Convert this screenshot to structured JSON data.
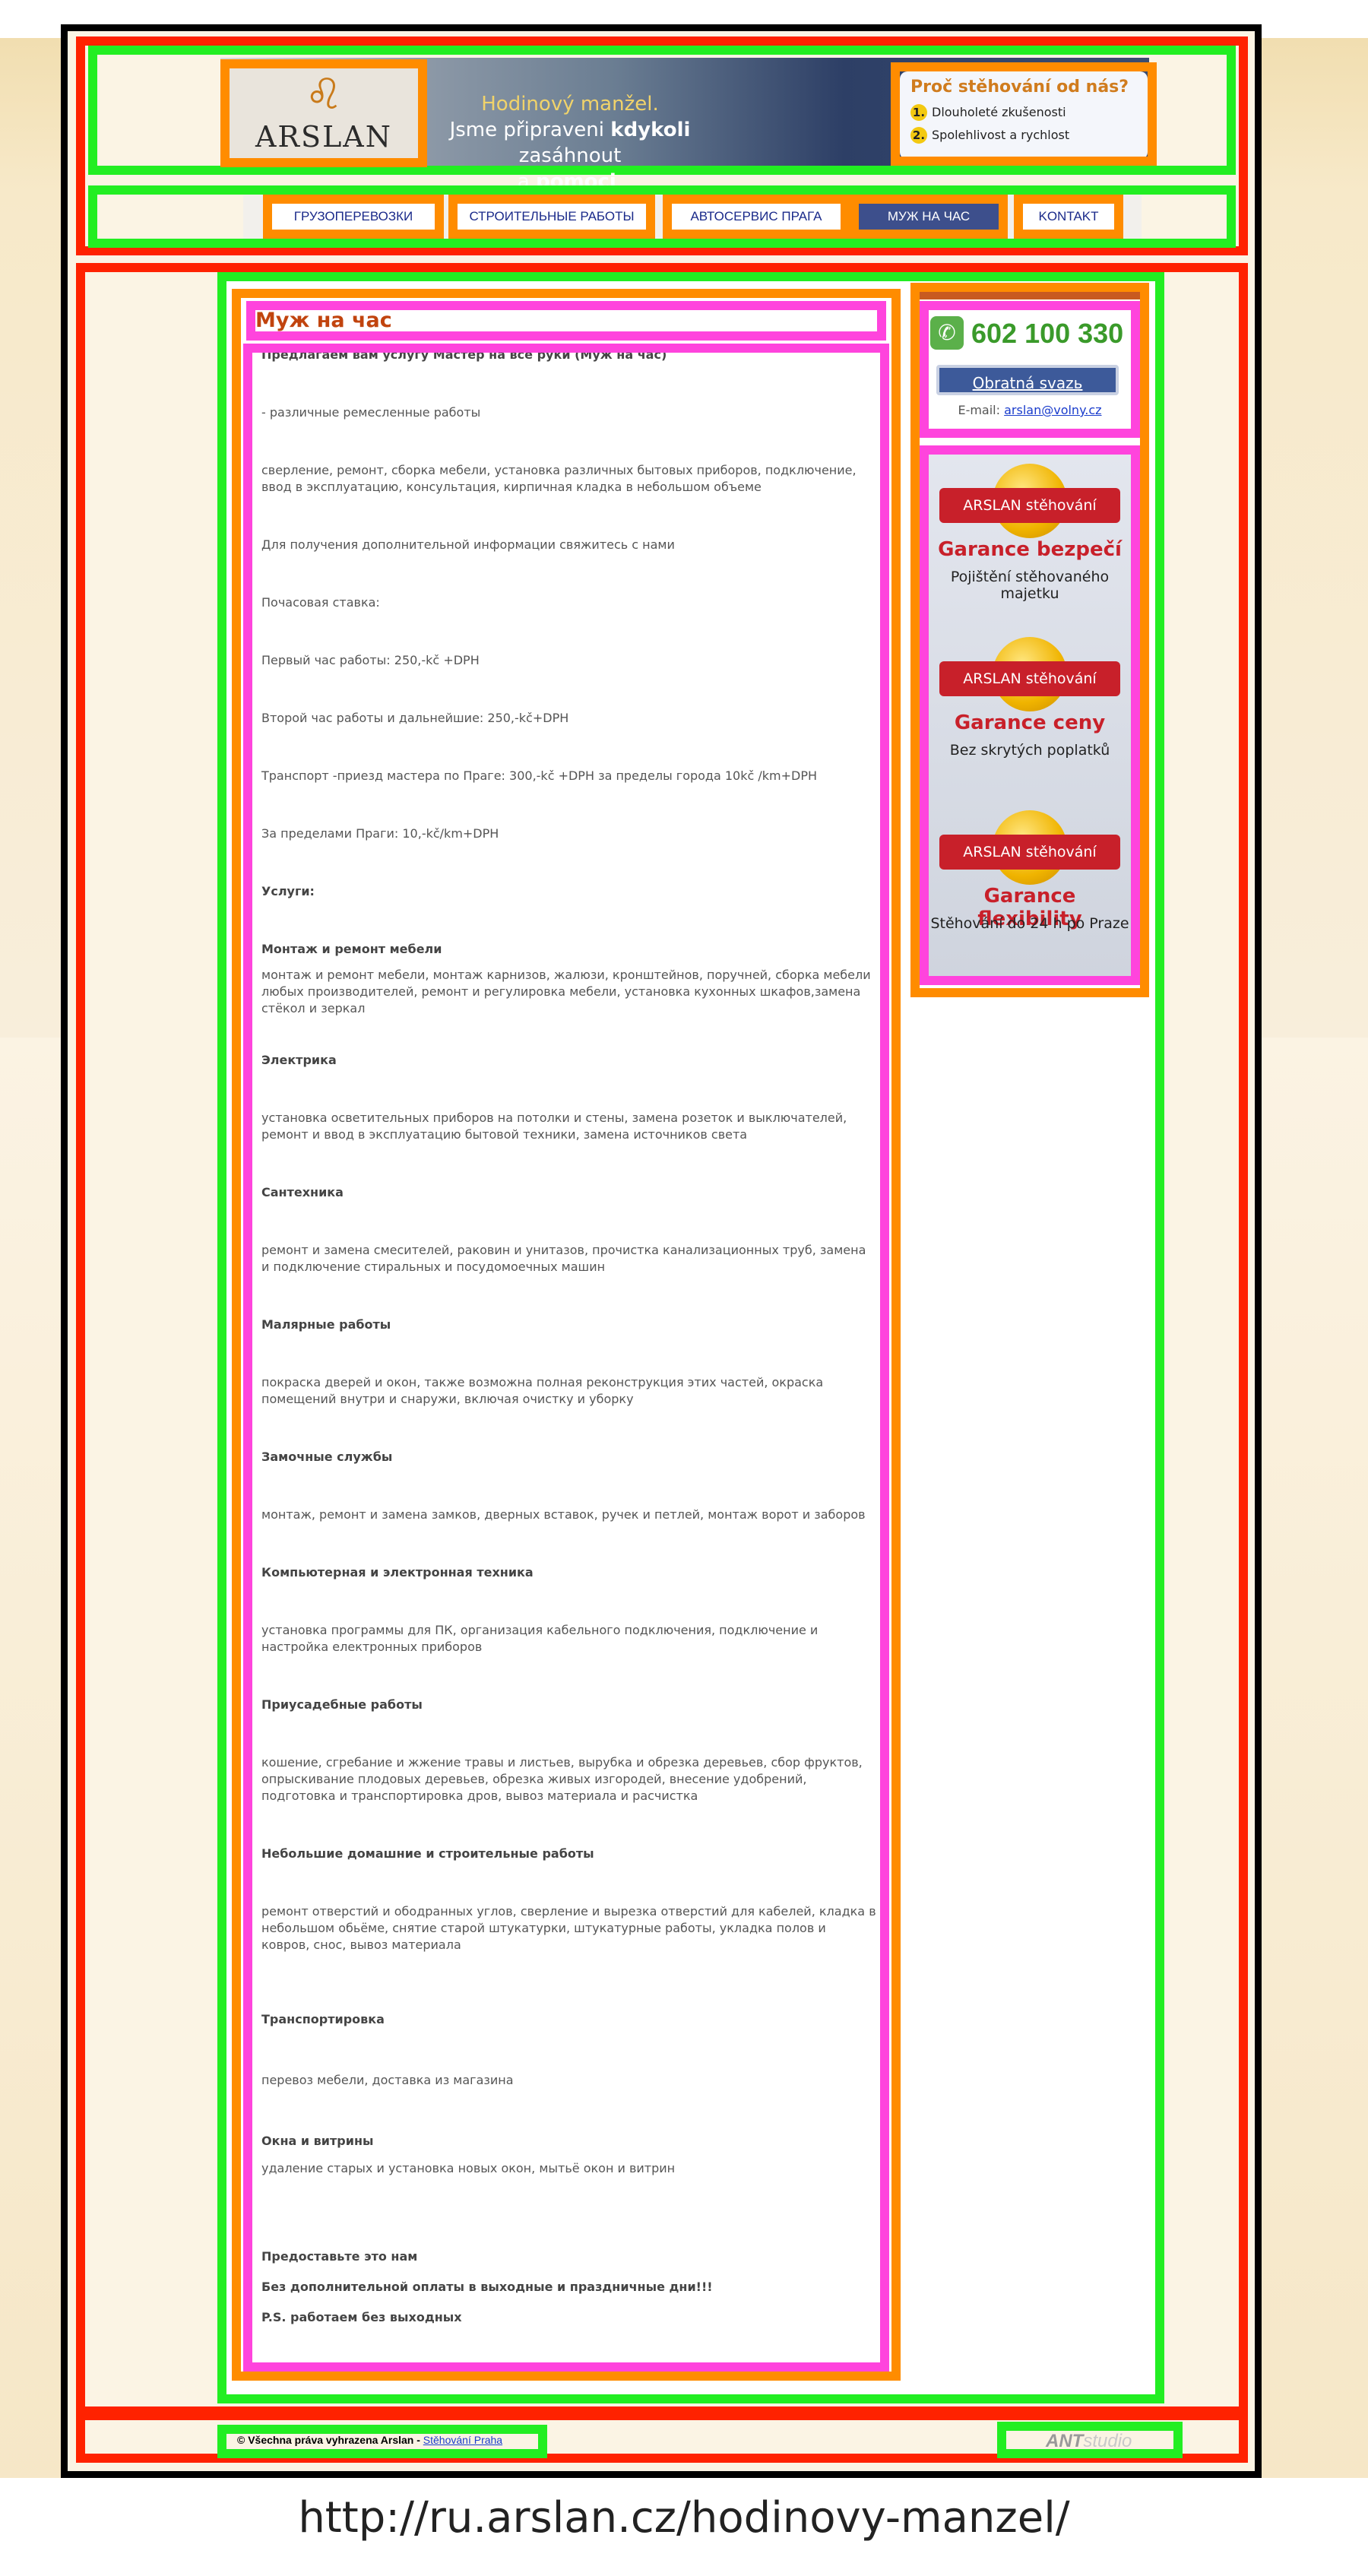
{
  "header": {
    "logo_text": "ARSLAN",
    "banner_line1": "Hodinový manžel.",
    "banner_line2_a": "Jsme připraveni ",
    "banner_line2_b": "kdykoli",
    "banner_line2_c": " zasáhnout",
    "banner_line3_a": "a ",
    "banner_line3_b": "pomoci",
    "banner_line3_c": ".",
    "why_title": "Proč stěhování od nás?",
    "why_items": [
      {
        "num": "1.",
        "text": "Dlouholeté zkušenosti"
      },
      {
        "num": "2.",
        "text": "Spolehlivost a rychlost"
      }
    ]
  },
  "nav": {
    "items": [
      {
        "label": "ГРУЗОПЕРЕВОЗКИ"
      },
      {
        "label": "СТРОИТЕЛЬНЫЕ РАБОТЫ"
      },
      {
        "label": "АВТОСЕРВИС ПРАГА"
      },
      {
        "label": "МУЖ НА ЧАС"
      },
      {
        "label": "KONTAKT"
      }
    ]
  },
  "main": {
    "title": "Муж на час",
    "paragraphs": [
      "Предлагаем вам услугу Мастер на все руки  (Муж на час)",
      " - различные ремесленные работы",
      " сверление, ремонт, сборка мебели, установка различных бытовых приборов, подключение, ввод в эксплуатацию, консультация, кирпичная кладка в небольшом объеме",
      "  Для получения дополнительной информации свяжитесь с нами",
      "  Почасовая ставка:",
      " Первый час работы: 250,-kč +DPH",
      " Второй час работы и дальнейшие: 250,-kč+DPH",
      " Транспорт -приезд мастера по Праге: 300,-kč +DPH        за пределы города 10kč /km+DPH",
      " За пределами Праги: 10,-kč/km+DPH",
      "Услуги:",
      "Монтаж и ремонт мебели",
      "монтаж и ремонт мебели, монтаж карнизов, жалюзи, кронштейнов, поручней, сборка мебели любых производителей, ремонт и регулировка мебели, установка кухонных шкафов,замена стёкол и зеркал",
      " Электрика",
      " установка осветительных приборов на потолки и стены, замена розеток и выключателей, ремонт и ввод в эксплуатацию бытовой техники, замена источников света",
      " Сантехника",
      " ремонт и замена смесителей, раковин и унитазов, прочистка канализационных труб, замена и подключение стиральных и посудомоечных машин",
      " Малярные работы",
      " покраска дверей и окон, также возможна полная реконструкция этих частей, окраска помещений внутри и снаружи, включая очистку и уборку",
      " Замочные службы",
      " монтаж, ремонт и замена замков, дверных вставок, ручек и петлей, монтаж ворот и заборов",
      "  Компьютерная и электронная техника",
      " установка программы для ПК, организация кабельного подключения, подключение и настройка електронных приборов",
      "   Приусадебные работы",
      " кошение, сгребание и жжение травы и листьев, вырубка и обрезка деревьев, сбор фруктов, опрыскивание плодовых деревьев, обрезка живых изгородей, внесение удобрений, подготовка и транспортировка дров, вывоз материала и расчистка",
      "   Небольшие домашние и строительные работы",
      " ремонт отверстий и ободранных углов, сверление и вырезка отверстий для кабелей, кладка в небольшом обьёме, снятие старой штукатурки, штукатурные работы, укладка полов и ковров, снос, вывоз материала",
      "     Транспортировка",
      " перевоз мебели, доставка из магазина",
      "     Окна и витрины",
      " удаление старых и установка новых окон, мытьё окон и витрин",
      "  Предоставьте это нам",
      "  Без дополнительной оплаты в выходные и праздничные дни!!!",
      "  P.S.    работаем без выходных"
    ]
  },
  "sidebar": {
    "phone": "602 100 330",
    "feedback_label": "Obratná svazь",
    "email_label": "E-mail:",
    "email": "arslan@volny.cz",
    "badges": [
      {
        "ribbon": "ARSLAN stěhování",
        "title": "Garance bezpečí",
        "subtitle": "Pojištění stěhovaného majetku"
      },
      {
        "ribbon": "ARSLAN stěhování",
        "title": "Garance ceny",
        "subtitle": "Bez skrytých poplatků"
      },
      {
        "ribbon": "ARSLAN stěhování",
        "title": "Garance flexibility",
        "subtitle": "Stěhování do 24 h po Praze"
      }
    ]
  },
  "footer": {
    "copyright": "© Všechna práva vyhrazena Arslan - ",
    "copyright_link": "Stěhování Praha",
    "studio_a": "ANT",
    "studio_b": "studio"
  },
  "caption_url": "http://ru.arslan.cz/hodinovy-manzel/"
}
